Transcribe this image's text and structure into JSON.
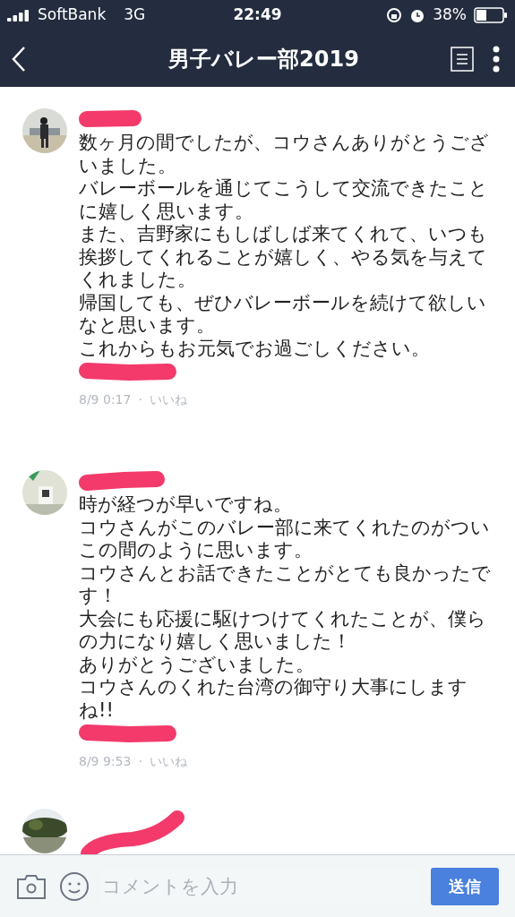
{
  "status_bar": {
    "carrier": "SoftBank",
    "network": "3G",
    "time": "22:49",
    "battery": "38%"
  },
  "nav": {
    "title": "男子バレー部2019"
  },
  "comments": [
    {
      "lines": [
        "数ヶ月の間でしたが、コウさんありがとうござ",
        "いました。",
        "バレーボールを通じてこうして交流できたこと",
        "に嬉しく思います。",
        "また、吉野家にもしばしば来てくれて、いつも",
        "挨拶してくれることが嬉しく、やる気を与えて",
        "くれました。",
        "帰国しても、ぜひバレーボールを続けて欲しい",
        "なと思います。",
        "これからもお元気でお過ごしください。"
      ],
      "time": "8/9 0:17",
      "separator": "·",
      "like": "いいね"
    },
    {
      "lines": [
        "時が経つが早いですね。",
        "コウさんがこのバレー部に来てくれたのがつい",
        "この間のように思います。",
        "コウさんとお話できたことがとても良かったで",
        "す！",
        "大会にも応援に駆けつけてくれたことが、僕ら",
        "の力になり嬉しく思いました！",
        "ありがとうございました。",
        "コウさんのくれた台湾の御守り大事にします",
        "ね!!"
      ],
      "time": "8/9 9:53",
      "separator": "·",
      "like": "いいね"
    }
  ],
  "composer": {
    "placeholder": "コメントを入力",
    "send": "送信"
  }
}
